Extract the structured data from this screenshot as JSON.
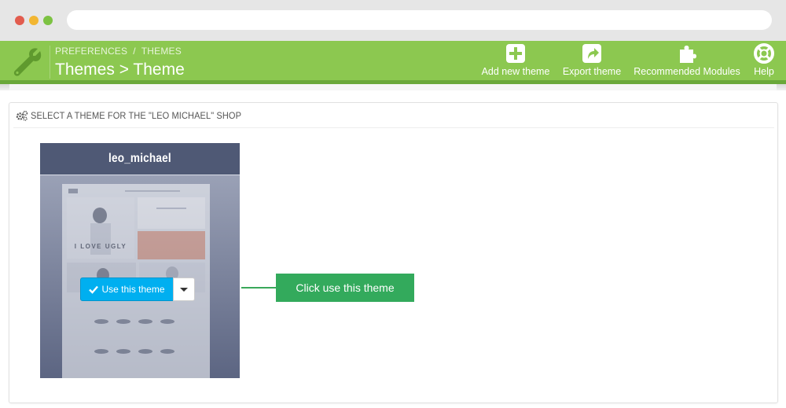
{
  "window": {
    "controls": [
      "close",
      "minimize",
      "maximize"
    ],
    "address": ""
  },
  "header": {
    "breadcrumb": [
      "PREFERENCES",
      "/",
      "THEMES"
    ],
    "title": "Themes > Theme",
    "icon": "wrench-icon",
    "toolbar": [
      {
        "label": "Add new theme",
        "icon": "plus-square-icon"
      },
      {
        "label": "Export theme",
        "icon": "share-square-icon"
      },
      {
        "label": "Recommended Modules",
        "icon": "puzzle-icon"
      },
      {
        "label": "Help",
        "icon": "lifebuoy-icon"
      }
    ]
  },
  "panel": {
    "heading": "SELECT A THEME FOR THE \"LEO MICHAEL\" SHOP",
    "heading_icon": "gears-icon",
    "theme": {
      "name": "leo_michael",
      "preview_text": "I LOVE UGLY",
      "use_button": "Use this theme"
    }
  },
  "callout": {
    "text": "Click use this theme"
  },
  "colors": {
    "header_green": "#8cc850",
    "use_button_blue": "#00aff0",
    "callout_green": "#33aa5c",
    "card_header": "#4f5975"
  }
}
